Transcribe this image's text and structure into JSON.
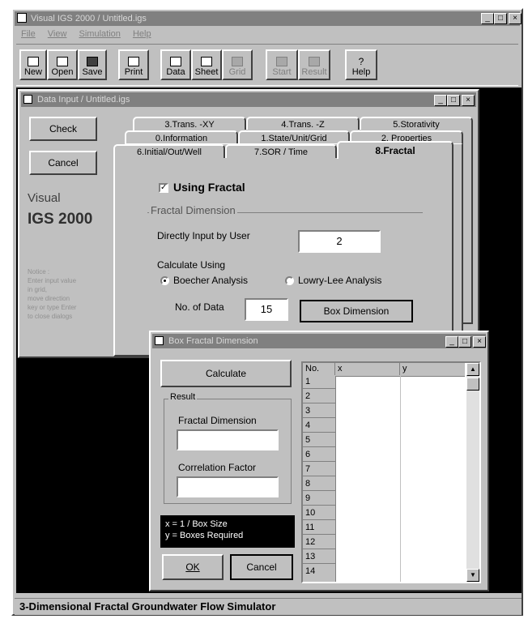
{
  "main_window": {
    "title": "Visual IGS 2000 / Untitled.igs",
    "menu": [
      "File",
      "View",
      "Simulation",
      "Help"
    ],
    "toolbar": [
      {
        "label": "New",
        "icon": "new-file-icon",
        "enabled": true
      },
      {
        "label": "Open",
        "icon": "open-folder-icon",
        "enabled": true
      },
      {
        "label": "Save",
        "icon": "save-disk-icon",
        "enabled": true
      },
      {
        "label": "Print",
        "icon": "print-icon",
        "enabled": true
      },
      {
        "label": "Data",
        "icon": "data-icon",
        "enabled": true
      },
      {
        "label": "Sheet",
        "icon": "sheet-icon",
        "enabled": true
      },
      {
        "label": "Grid",
        "icon": "grid-icon",
        "enabled": false
      },
      {
        "label": "Start",
        "icon": "start-icon",
        "enabled": false
      },
      {
        "label": "Result",
        "icon": "result-icon",
        "enabled": false
      },
      {
        "label": "Help",
        "icon": "help-icon",
        "enabled": true
      }
    ],
    "status_text": "3-Dimensional Fractal Groundwater Flow Simulator"
  },
  "data_input": {
    "title": "Data Input / Untitled.igs",
    "check_label": "Check",
    "cancel_label": "Cancel",
    "brand_line1": "Visual",
    "brand_line2": "IGS 2000",
    "notice_lines": [
      "Notice :",
      "Enter input value",
      "in grid,",
      "move direction",
      "key or type Enter",
      "to close dialogs"
    ],
    "tabs_row1": [
      "3.Trans. -XY",
      "4.Trans. -Z",
      "5.Storativity"
    ],
    "tabs_row2": [
      "0.Information",
      "1.State/Unit/Grid",
      "2. Properties"
    ],
    "tabs_row3": [
      "6.Initial/Out/Well",
      "7.SOR / Time",
      "8.Fractal"
    ],
    "using_fractal_label": "Using Fractal",
    "fractal_dimension_group": "Fractal Dimension",
    "direct_input_label": "Directly Input by User",
    "direct_input_value": "2",
    "calculate_using_label": "Calculate Using",
    "boecher_label": "Boecher Analysis",
    "lowry_label": "Lowry-Lee Analysis",
    "num_data_label": "No. of Data",
    "num_data_value": "15",
    "box_dimension_label": "Box Dimension"
  },
  "box_dialog": {
    "title": "Box Fractal Dimension",
    "calculate_label": "Calculate",
    "result_group": "Result",
    "fractal_dimension_label": "Fractal Dimension",
    "fractal_dimension_value": "",
    "correlation_label": "Correlation Factor",
    "correlation_value": "",
    "legend_line1": "x = 1 / Box Size",
    "legend_line2": "y = Boxes Required",
    "ok_label": "OK",
    "cancel_label": "Cancel",
    "grid_headers": [
      "No.",
      "x",
      "y"
    ],
    "grid_rows": [
      "1",
      "2",
      "3",
      "4",
      "5",
      "6",
      "7",
      "8",
      "9",
      "10",
      "11",
      "12",
      "13",
      "14"
    ]
  }
}
